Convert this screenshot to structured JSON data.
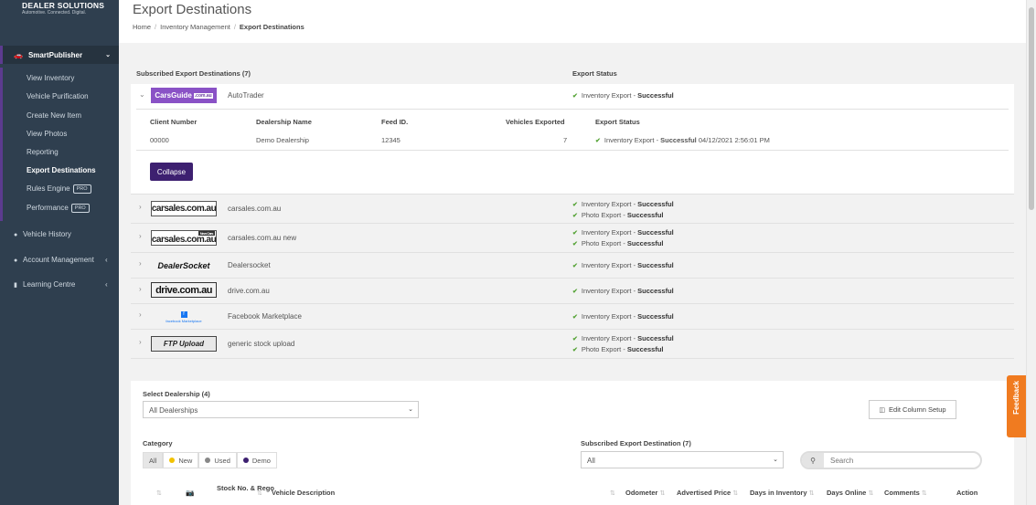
{
  "brand": {
    "top": "",
    "name": "DEALER SOLUTIONS",
    "tagline": "Automotive. Connected. Digital."
  },
  "sidebar": {
    "section": "SmartPublisher",
    "sub_items": [
      {
        "label": "View Inventory"
      },
      {
        "label": "Vehicle Purification"
      },
      {
        "label": "Create New Item"
      },
      {
        "label": "View Photos"
      },
      {
        "label": "Reporting"
      },
      {
        "label": "Export Destinations"
      },
      {
        "label": "Rules Engine",
        "badge": "PRO"
      },
      {
        "label": "Performance",
        "badge": "PRO"
      }
    ],
    "main_items": [
      {
        "label": "Vehicle History"
      },
      {
        "label": "Account Management"
      },
      {
        "label": "Learning Centre"
      }
    ]
  },
  "header": {
    "title": "Export Destinations",
    "breadcrumb": [
      "Home",
      "Inventory Management",
      "Export Destinations"
    ]
  },
  "destinations": {
    "header_left": "Subscribed Export Destinations (7)",
    "header_right": "Export Status",
    "rows": [
      {
        "logo": "CarsGuide",
        "logo_suffix": ".com.au",
        "name": "AutoTrader",
        "statuses": [
          {
            "type": "Inventory Export",
            "result": "Successful"
          }
        ]
      },
      {
        "logo": "carsales.com.au",
        "name": "carsales.com.au",
        "statuses": [
          {
            "type": "Inventory Export",
            "result": "Successful"
          },
          {
            "type": "Photo Export",
            "result": "Successful"
          }
        ]
      },
      {
        "logo": "carsales.com.au",
        "logo_tag": "New Cars",
        "name": "carsales.com.au new",
        "statuses": [
          {
            "type": "Inventory Export",
            "result": "Successful"
          },
          {
            "type": "Photo Export",
            "result": "Successful"
          }
        ]
      },
      {
        "logo": "DealerSocket",
        "name": "Dealersocket",
        "statuses": [
          {
            "type": "Inventory Export",
            "result": "Successful"
          }
        ]
      },
      {
        "logo": "drive.com.au",
        "name": "drive.com.au",
        "statuses": [
          {
            "type": "Inventory Export",
            "result": "Successful"
          }
        ]
      },
      {
        "logo": "f",
        "logo_caption": "facebook Marketplace",
        "name": "Facebook Marketplace",
        "statuses": [
          {
            "type": "Inventory Export",
            "result": "Successful"
          }
        ]
      },
      {
        "logo": "FTP Upload",
        "name": "generic stock upload",
        "statuses": [
          {
            "type": "Inventory Export",
            "result": "Successful"
          },
          {
            "type": "Photo Export",
            "result": "Successful"
          }
        ]
      }
    ],
    "detail": {
      "headers": [
        "Client Number",
        "Dealership Name",
        "Feed ID.",
        "Vehicles Exported",
        "Export Status"
      ],
      "values": {
        "client_number": "00000",
        "dealership_name": "Demo Dealership",
        "feed_id": "12345",
        "vehicles_exported": "7",
        "status_type": "Inventory Export",
        "status_result": "Successful",
        "status_time": "04/12/2021 2:56:01 PM"
      },
      "collapse_label": "Collapse"
    }
  },
  "filters": {
    "dealership_label": "Select Dealership (4)",
    "dealership_value": "All Dealerships",
    "edit_column_label": "Edit Column Setup",
    "category_label": "Category",
    "categories": [
      {
        "label": "All"
      },
      {
        "label": "New",
        "color": "#f2c200"
      },
      {
        "label": "Used",
        "color": "#888888"
      },
      {
        "label": "Demo",
        "color": "#3d2070"
      }
    ],
    "destination_label": "Subscribed Export Destination (7)",
    "destination_value": "All",
    "search_placeholder": "Search"
  },
  "table": {
    "columns": [
      "Stock No. & Rego",
      "Vehicle Description",
      "Odometer",
      "Advertised Price",
      "Days in Inventory",
      "Days Online",
      "Comments",
      "Action"
    ]
  },
  "feedback_label": "Feedback",
  "colors": {
    "sidebar": "#2f3f4f",
    "accent": "#3d2070",
    "success": "#55a336",
    "feedback": "#f07b20"
  }
}
